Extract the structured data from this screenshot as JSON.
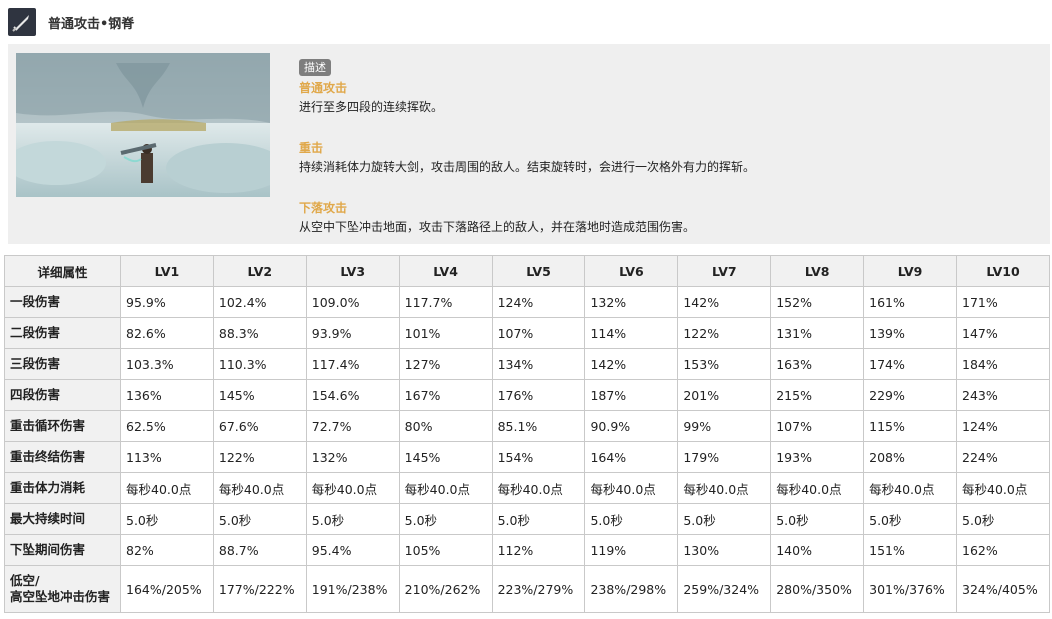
{
  "header": {
    "title": "普通攻击•钢脊",
    "icon": "sword-icon"
  },
  "description": {
    "tag": "描述",
    "sections": [
      {
        "title": "普通攻击",
        "body": "进行至多四段的连续挥砍。"
      },
      {
        "title": "重击",
        "body": "持续消耗体力旋转大剑，攻击周围的敌人。结束旋转时，会进行一次格外有力的挥斩。"
      },
      {
        "title": "下落攻击",
        "body": "从空中下坠冲击地面，攻击下落路径上的敌人，并在落地时造成范围伤害。"
      }
    ]
  },
  "table": {
    "headers": [
      "详细属性",
      "LV1",
      "LV2",
      "LV3",
      "LV4",
      "LV5",
      "LV6",
      "LV7",
      "LV8",
      "LV9",
      "LV10"
    ],
    "rows": [
      {
        "label": "一段伤害",
        "values": [
          "95.9%",
          "102.4%",
          "109.0%",
          "117.7%",
          "124%",
          "132%",
          "142%",
          "152%",
          "161%",
          "171%"
        ]
      },
      {
        "label": "二段伤害",
        "values": [
          "82.6%",
          "88.3%",
          "93.9%",
          "101%",
          "107%",
          "114%",
          "122%",
          "131%",
          "139%",
          "147%"
        ]
      },
      {
        "label": "三段伤害",
        "values": [
          "103.3%",
          "110.3%",
          "117.4%",
          "127%",
          "134%",
          "142%",
          "153%",
          "163%",
          "174%",
          "184%"
        ]
      },
      {
        "label": "四段伤害",
        "values": [
          "136%",
          "145%",
          "154.6%",
          "167%",
          "176%",
          "187%",
          "201%",
          "215%",
          "229%",
          "243%"
        ]
      },
      {
        "label": "重击循环伤害",
        "values": [
          "62.5%",
          "67.6%",
          "72.7%",
          "80%",
          "85.1%",
          "90.9%",
          "99%",
          "107%",
          "115%",
          "124%"
        ]
      },
      {
        "label": "重击终结伤害",
        "values": [
          "113%",
          "122%",
          "132%",
          "145%",
          "154%",
          "164%",
          "179%",
          "193%",
          "208%",
          "224%"
        ]
      },
      {
        "label": "重击体力消耗",
        "values": [
          "每秒40.0点",
          "每秒40.0点",
          "每秒40.0点",
          "每秒40.0点",
          "每秒40.0点",
          "每秒40.0点",
          "每秒40.0点",
          "每秒40.0点",
          "每秒40.0点",
          "每秒40.0点"
        ]
      },
      {
        "label": "最大持续时间",
        "values": [
          "5.0秒",
          "5.0秒",
          "5.0秒",
          "5.0秒",
          "5.0秒",
          "5.0秒",
          "5.0秒",
          "5.0秒",
          "5.0秒",
          "5.0秒"
        ]
      },
      {
        "label": "下坠期间伤害",
        "values": [
          "82%",
          "88.7%",
          "95.4%",
          "105%",
          "112%",
          "119%",
          "130%",
          "140%",
          "151%",
          "162%"
        ]
      },
      {
        "label": "低空/\n高空坠地冲击伤害",
        "values": [
          "164%/205%",
          "177%/222%",
          "191%/238%",
          "210%/262%",
          "223%/279%",
          "238%/298%",
          "259%/324%",
          "280%/350%",
          "301%/376%",
          "324%/405%"
        ]
      }
    ]
  },
  "colors": {
    "section_title": "#e0a84a",
    "panel_bg": "#efefef",
    "header_cell_bg": "#f1f1f1",
    "border": "#c9c9c9"
  }
}
